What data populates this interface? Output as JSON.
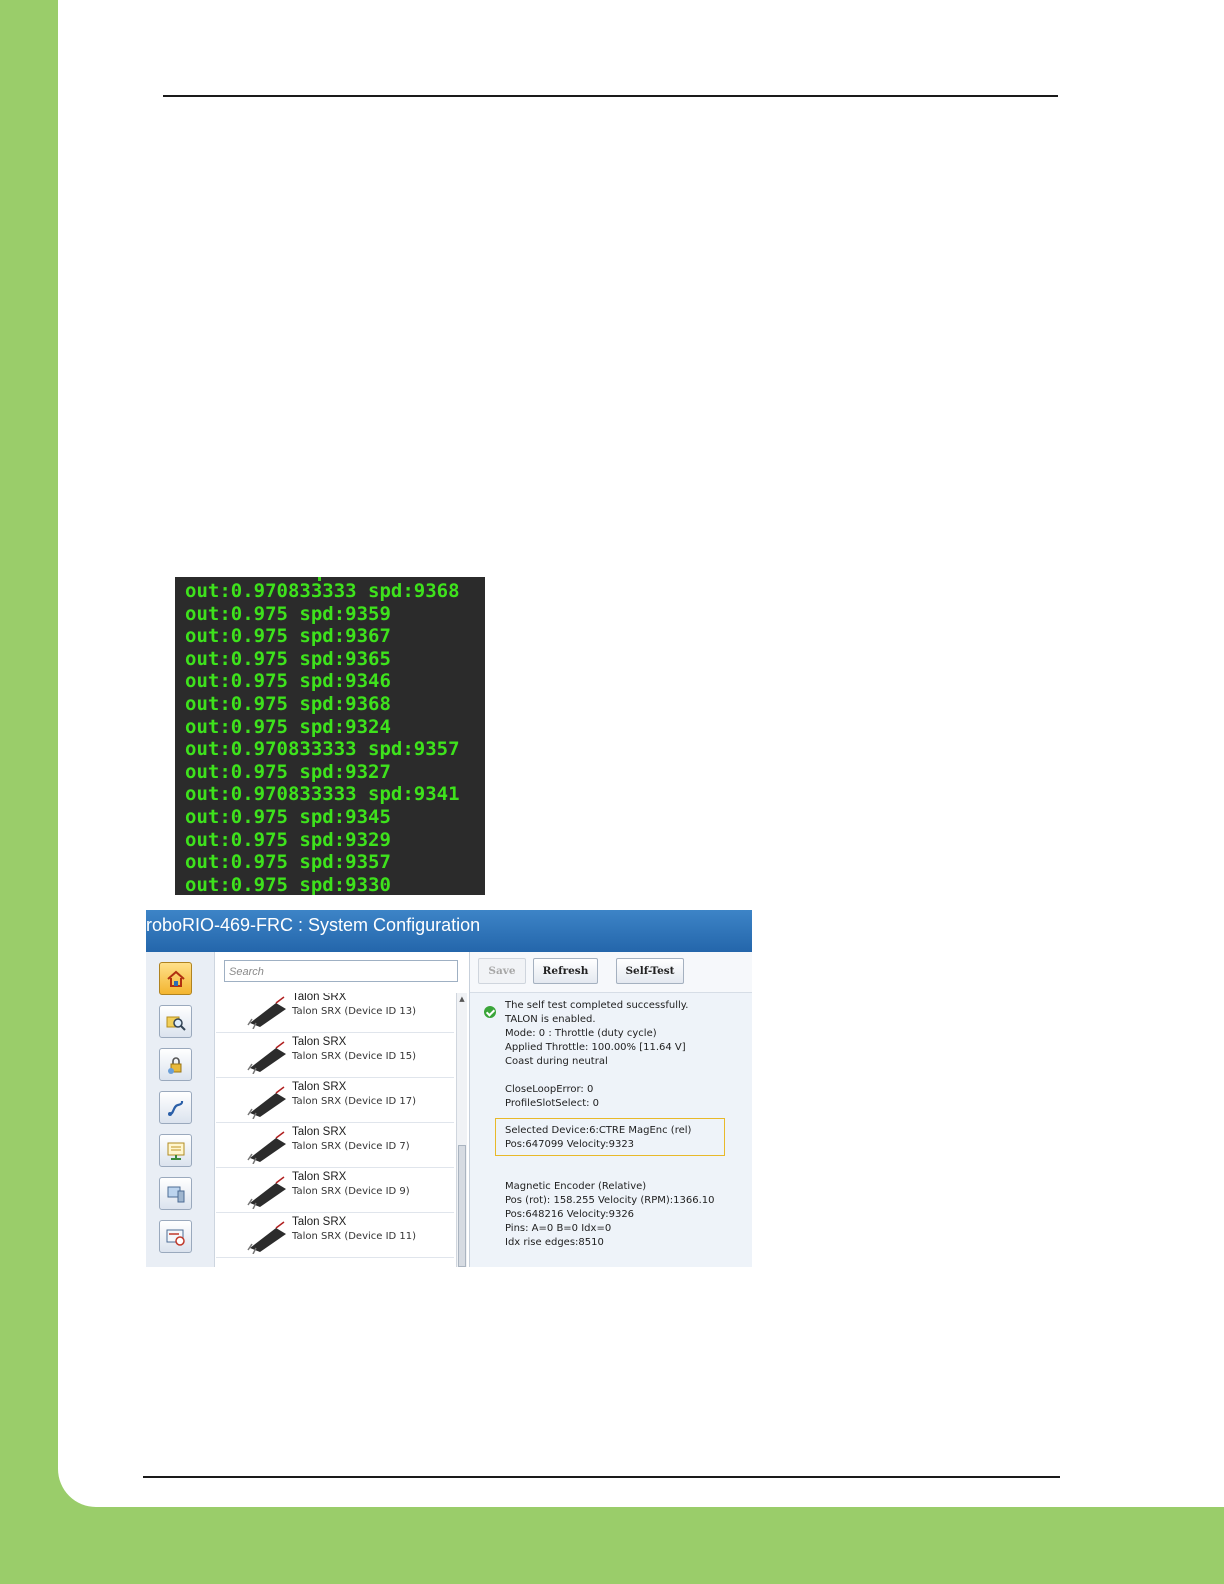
{
  "console": {
    "lines": [
      "out:0.970833333 spd:9368",
      "out:0.975 spd:9359",
      "out:0.975 spd:9367",
      "out:0.975 spd:9365",
      "out:0.975 spd:9346",
      "out:0.975 spd:9368",
      "out:0.975 spd:9324",
      "out:0.970833333 spd:9357",
      "out:0.975 spd:9327",
      "out:0.970833333 spd:9341",
      "out:0.975 spd:9345",
      "out:0.975 spd:9329",
      "out:0.975 spd:9357",
      "out:0.975 spd:9330"
    ]
  },
  "config": {
    "title": "roboRIO-469-FRC : System Configuration",
    "search_placeholder": "Search",
    "buttons": {
      "save": "Save",
      "refresh": "Refresh",
      "self_test": "Self-Test"
    },
    "devices": [
      {
        "name": "Talon SRX",
        "sub": "Talon SRX (Device ID 13)"
      },
      {
        "name": "Talon SRX",
        "sub": "Talon SRX (Device ID 15)"
      },
      {
        "name": "Talon SRX",
        "sub": "Talon SRX (Device ID 17)"
      },
      {
        "name": "Talon SRX",
        "sub": "Talon SRX (Device ID 7)"
      },
      {
        "name": "Talon SRX",
        "sub": "Talon SRX (Device ID 9)"
      },
      {
        "name": "Talon SRX",
        "sub": "Talon SRX (Device ID 11)"
      }
    ],
    "details": {
      "status": [
        "The self test completed successfully.",
        "TALON is enabled.",
        "Mode: 0 : Throttle (duty cycle)",
        "Applied Throttle:  100.00% [11.64 V]",
        "Coast during neutral"
      ],
      "loop": [
        "CloseLoopError: 0",
        "ProfileSlotSelect: 0"
      ],
      "selected": [
        "Selected Device:6:CTRE MagEnc (rel)",
        "Pos:647099   Velocity:9323"
      ],
      "encoder": [
        "Magnetic Encoder (Relative)",
        "Pos (rot): 158.255  Velocity (RPM):1366.10",
        "Pos:648216   Velocity:9326",
        "Pins: A=0 B=0 Idx=0",
        "Idx rise edges:8510"
      ]
    },
    "tool_icons": [
      "home-icon",
      "browse-search-icon",
      "lock-icon",
      "network-icon",
      "display-icon",
      "monitor-icon",
      "settings-icon"
    ],
    "accent": "#2a6db5",
    "status_ok": "#3aa53a"
  },
  "colors": {
    "border_green": "#9acd6a",
    "console_bg": "#2b2b2b",
    "console_text": "#3ee21c",
    "highlight_box": "#e8b92a"
  }
}
